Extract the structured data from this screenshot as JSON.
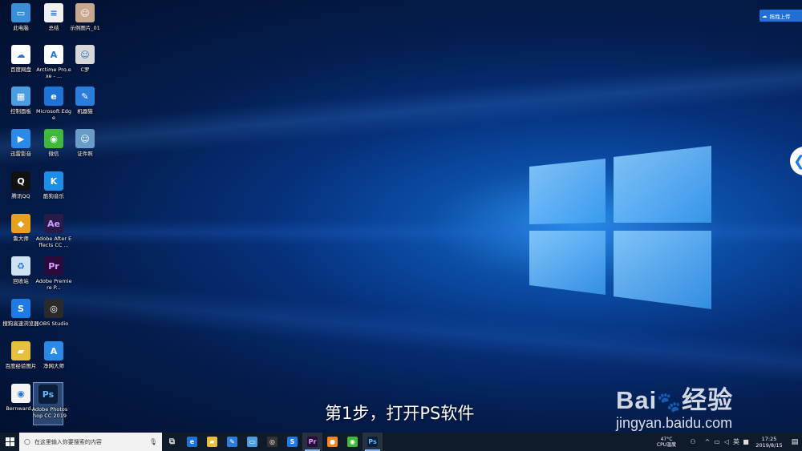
{
  "desktop_icons": [
    {
      "label": "此电脑",
      "icon": "computer-icon",
      "bg": "#3a8fd8",
      "glyph": "▭"
    },
    {
      "label": "总结",
      "icon": "document-icon",
      "bg": "#f0f0f0",
      "glyph": "≡"
    },
    {
      "label": "示例图片_01",
      "icon": "photo-icon",
      "bg": "#c9a890",
      "glyph": "☺"
    },
    {
      "label": "百度网盘",
      "icon": "baidu-netdisk-icon",
      "bg": "#ffffff",
      "glyph": "☁"
    },
    {
      "label": "Arctime Pro.exe - ...",
      "icon": "arctime-icon",
      "bg": "#ffffff",
      "glyph": "A"
    },
    {
      "label": "C罗",
      "icon": "photo-icon",
      "bg": "#d8d8d8",
      "glyph": "☺"
    },
    {
      "label": "控制面板",
      "icon": "control-panel-icon",
      "bg": "#4a9de0",
      "glyph": "▦"
    },
    {
      "label": "Microsoft Edge",
      "icon": "edge-icon",
      "bg": "#1e73d6",
      "glyph": "e"
    },
    {
      "label": "机器猫",
      "icon": "shortcut-icon",
      "bg": "#2b7ddc",
      "glyph": "✎"
    },
    {
      "label": "迅雷影音",
      "icon": "xunlei-icon",
      "bg": "#2a8ae8",
      "glyph": "▶"
    },
    {
      "label": "微信",
      "icon": "wechat-icon",
      "bg": "#3fb83c",
      "glyph": "◉"
    },
    {
      "label": "证件照",
      "icon": "id-photo-icon",
      "bg": "#6a9cc8",
      "glyph": "☺"
    },
    {
      "label": "腾讯QQ",
      "icon": "qq-icon",
      "bg": "#111111",
      "glyph": "Q"
    },
    {
      "label": "酷狗音乐",
      "icon": "kugou-icon",
      "bg": "#1a8fe8",
      "glyph": "K"
    },
    {
      "label": "鲁大师",
      "icon": "ludashi-icon",
      "bg": "#e8a020",
      "glyph": "◆"
    },
    {
      "label": "Adobe After Effects CC ...",
      "icon": "after-effects-icon",
      "bg": "#2a1a4a",
      "glyph": "Ae"
    },
    {
      "label": "回收站",
      "icon": "recycle-bin-icon",
      "bg": "#cfe2f2",
      "glyph": "♻"
    },
    {
      "label": "Adobe Premiere P...",
      "icon": "premiere-icon",
      "bg": "#2a0a3a",
      "glyph": "Pr"
    },
    {
      "label": "搜狗高速浏览器",
      "icon": "sogou-browser-icon",
      "bg": "#1e7be6",
      "glyph": "S"
    },
    {
      "label": "OBS Studio",
      "icon": "obs-icon",
      "bg": "#2a2a2a",
      "glyph": "◎"
    },
    {
      "label": "百度经验图片",
      "icon": "folder-icon",
      "bg": "#e8c040",
      "glyph": "▰"
    },
    {
      "label": "净网大师",
      "icon": "jingwang-icon",
      "bg": "#2a8ae8",
      "glyph": "A"
    },
    {
      "label": "Bernward...",
      "icon": "bernward-icon",
      "bg": "#f4f4f4",
      "glyph": "◉"
    },
    {
      "label": "Adobe Photoshop CC 2019",
      "icon": "photoshop-icon",
      "bg": "#0a1e3a",
      "glyph": "Ps"
    }
  ],
  "top_right": {
    "button_label": "拖拽上传"
  },
  "subtitle": "第1步，打开PS软件",
  "watermark": {
    "logo": "Bai",
    "logo_cn": "经验",
    "url": "jingyan.baidu.com"
  },
  "taskbar": {
    "search_placeholder": "在这里输入你要搜索的内容",
    "apps": [
      {
        "name": "task-view",
        "glyph": "⧉",
        "bg": "transparent"
      },
      {
        "name": "edge",
        "glyph": "e",
        "bg": "#1e73d6"
      },
      {
        "name": "file-explorer",
        "glyph": "▰",
        "bg": "#e8c040"
      },
      {
        "name": "app-1",
        "glyph": "✎",
        "bg": "#2b7ddc"
      },
      {
        "name": "app-2",
        "glyph": "▭",
        "bg": "#4a9de0"
      },
      {
        "name": "obs",
        "glyph": "◎",
        "bg": "#333333"
      },
      {
        "name": "sogou",
        "glyph": "S",
        "bg": "#1e7be6"
      },
      {
        "name": "premiere",
        "glyph": "Pr",
        "bg": "#2a0a3a"
      },
      {
        "name": "app-3",
        "glyph": "●",
        "bg": "#f08a20"
      },
      {
        "name": "wechat",
        "glyph": "◉",
        "bg": "#3fb83c"
      },
      {
        "name": "photoshop",
        "glyph": "Ps",
        "bg": "#0a1e3a"
      }
    ],
    "cpu_temp": "47°C",
    "cpu_label": "CPU温度",
    "time": "17:25",
    "date": "2019/8/15",
    "ime": "英"
  }
}
